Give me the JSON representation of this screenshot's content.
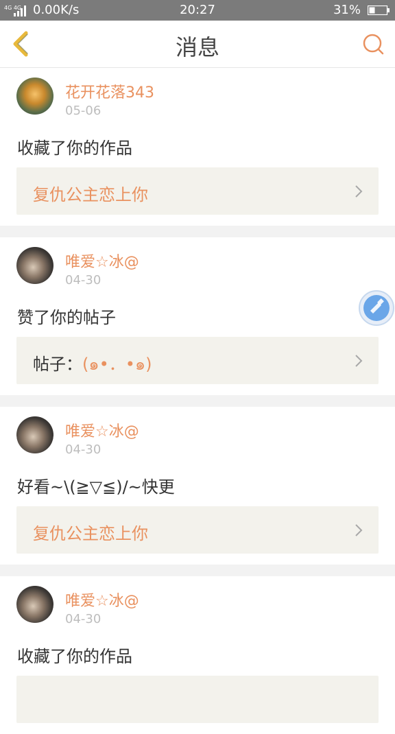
{
  "status_bar": {
    "network_label": "4G 4G",
    "speed": "0.00K/s",
    "time": "20:27",
    "battery_percent": "31%"
  },
  "nav": {
    "title": "消息"
  },
  "messages": [
    {
      "username": "花开花落343",
      "date": "05-06",
      "action": "收藏了你的作品",
      "box_prefix": "",
      "box_text": "复仇公主恋上你"
    },
    {
      "username": "唯爱☆冰@",
      "date": "04-30",
      "action": "赞了你的帖子",
      "box_prefix": "帖子：",
      "box_text": "(๑•．•๑)"
    },
    {
      "username": "唯爱☆冰@",
      "date": "04-30",
      "action": "好看~\\(≧▽≦)/~快更",
      "box_prefix": "",
      "box_text": "复仇公主恋上你"
    },
    {
      "username": "唯爱☆冰@",
      "date": "04-30",
      "action": "收藏了你的作品",
      "box_prefix": "",
      "box_text": ""
    }
  ],
  "colors": {
    "accent": "#e9915f",
    "back_arrow": "#e8b93c",
    "status_bar_bg": "#7b7b7b",
    "box_bg": "#f3f2ec",
    "float_button": "#6aa6e8"
  }
}
